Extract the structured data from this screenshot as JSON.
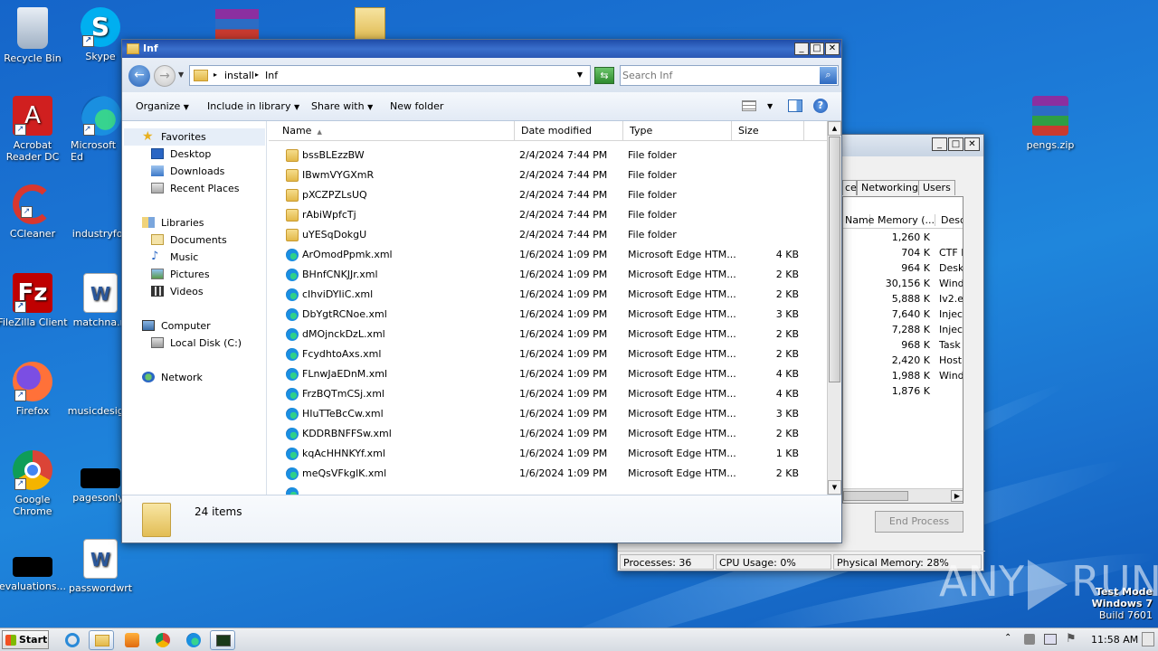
{
  "desktop": {
    "icons": [
      {
        "label": "Recycle Bin",
        "icon": "recycle-bin-icon"
      },
      {
        "label": "Skype",
        "icon": "skype-icon"
      },
      {
        "label": "Acrobat Reader DC",
        "icon": "acrobat-icon"
      },
      {
        "label": "Microsoft Ed",
        "icon": "edge-icon"
      },
      {
        "label": "CCleaner",
        "icon": "ccleaner-icon"
      },
      {
        "label": "industryfoo",
        "icon": "blank-icon"
      },
      {
        "label": "FileZilla Client",
        "icon": "filezilla-icon"
      },
      {
        "label": "matchna.rt",
        "icon": "word-doc-icon"
      },
      {
        "label": "Firefox",
        "icon": "firefox-icon"
      },
      {
        "label": "musicdesig...",
        "icon": "blank-icon"
      },
      {
        "label": "Google Chrome",
        "icon": "chrome-icon"
      },
      {
        "label": "pagesonly.j",
        "icon": "black-thumb-icon"
      },
      {
        "label": "evaluations...",
        "icon": "black-thumb-icon"
      },
      {
        "label": "passwordwrt",
        "icon": "word-doc-icon"
      },
      {
        "label": "pengs.zip",
        "icon": "winrar-icon"
      }
    ],
    "watermark": {
      "brand": "ANY",
      "brand2": "RUN"
    },
    "test_mode": {
      "line1": "Test Mode",
      "line2": "Windows 7",
      "line3": "Build 7601"
    }
  },
  "explorer": {
    "title": "Inf",
    "breadcrumb": [
      "install",
      "Inf"
    ],
    "search_placeholder": "Search Inf",
    "toolbar": {
      "organize": "Organize",
      "include": "Include in library",
      "share": "Share with",
      "new_folder": "New folder"
    },
    "nav": {
      "favorites": "Favorites",
      "desktop": "Desktop",
      "downloads": "Downloads",
      "recent": "Recent Places",
      "libraries": "Libraries",
      "documents": "Documents",
      "music": "Music",
      "pictures": "Pictures",
      "videos": "Videos",
      "computer": "Computer",
      "local_disk": "Local Disk (C:)",
      "network": "Network"
    },
    "columns": {
      "name": "Name",
      "date": "Date modified",
      "type": "Type",
      "size": "Size"
    },
    "files": [
      {
        "name": "bssBLEzzBW",
        "date": "2/4/2024 7:44 PM",
        "type": "File folder",
        "size": "",
        "kind": "folder"
      },
      {
        "name": "IBwmVYGXmR",
        "date": "2/4/2024 7:44 PM",
        "type": "File folder",
        "size": "",
        "kind": "folder"
      },
      {
        "name": "pXCZPZLsUQ",
        "date": "2/4/2024 7:44 PM",
        "type": "File folder",
        "size": "",
        "kind": "folder"
      },
      {
        "name": "rAbiWpfcTj",
        "date": "2/4/2024 7:44 PM",
        "type": "File folder",
        "size": "",
        "kind": "folder"
      },
      {
        "name": "uYESqDokgU",
        "date": "2/4/2024 7:44 PM",
        "type": "File folder",
        "size": "",
        "kind": "folder"
      },
      {
        "name": "ArOmodPpmk.xml",
        "date": "1/6/2024 1:09 PM",
        "type": "Microsoft Edge HTM...",
        "size": "4 KB",
        "kind": "edge"
      },
      {
        "name": "BHnfCNKJJr.xml",
        "date": "1/6/2024 1:09 PM",
        "type": "Microsoft Edge HTM...",
        "size": "2 KB",
        "kind": "edge"
      },
      {
        "name": "cIhviDYIiC.xml",
        "date": "1/6/2024 1:09 PM",
        "type": "Microsoft Edge HTM...",
        "size": "2 KB",
        "kind": "edge"
      },
      {
        "name": "DbYgtRCNoe.xml",
        "date": "1/6/2024 1:09 PM",
        "type": "Microsoft Edge HTM...",
        "size": "3 KB",
        "kind": "edge"
      },
      {
        "name": "dMOjnckDzL.xml",
        "date": "1/6/2024 1:09 PM",
        "type": "Microsoft Edge HTM...",
        "size": "2 KB",
        "kind": "edge"
      },
      {
        "name": "FcydhtoAxs.xml",
        "date": "1/6/2024 1:09 PM",
        "type": "Microsoft Edge HTM...",
        "size": "2 KB",
        "kind": "edge"
      },
      {
        "name": "FLnwJaEDnM.xml",
        "date": "1/6/2024 1:09 PM",
        "type": "Microsoft Edge HTM...",
        "size": "4 KB",
        "kind": "edge"
      },
      {
        "name": "FrzBQTmCSj.xml",
        "date": "1/6/2024 1:09 PM",
        "type": "Microsoft Edge HTM...",
        "size": "4 KB",
        "kind": "edge"
      },
      {
        "name": "HIuTTeBcCw.xml",
        "date": "1/6/2024 1:09 PM",
        "type": "Microsoft Edge HTM...",
        "size": "3 KB",
        "kind": "edge"
      },
      {
        "name": "KDDRBNFFSw.xml",
        "date": "1/6/2024 1:09 PM",
        "type": "Microsoft Edge HTM...",
        "size": "2 KB",
        "kind": "edge"
      },
      {
        "name": "kqAcHHNKYf.xml",
        "date": "1/6/2024 1:09 PM",
        "type": "Microsoft Edge HTM...",
        "size": "1 KB",
        "kind": "edge"
      },
      {
        "name": "meQsVFkglK.xml",
        "date": "1/6/2024 1:09 PM",
        "type": "Microsoft Edge HTM...",
        "size": "2 KB",
        "kind": "edge"
      }
    ],
    "status": "24 items"
  },
  "task_manager": {
    "tabs": [
      "ce",
      "Networking",
      "Users"
    ],
    "columns": {
      "name": "Name",
      "memory": "Memory (...",
      "desc": "Desc"
    },
    "rows": [
      {
        "mem": "1,260 K",
        "desc": ""
      },
      {
        "mem": "704 K",
        "desc": "CTF I"
      },
      {
        "mem": "964 K",
        "desc": "Desk"
      },
      {
        "mem": "30,156 K",
        "desc": "Wind"
      },
      {
        "mem": "5,888 K",
        "desc": "Iv2.e"
      },
      {
        "mem": "7,640 K",
        "desc": "Injec"
      },
      {
        "mem": "7,288 K",
        "desc": "Injec"
      },
      {
        "mem": "968 K",
        "desc": "Task"
      },
      {
        "mem": "2,420 K",
        "desc": "Host"
      },
      {
        "mem": "1,988 K",
        "desc": "Wind"
      },
      {
        "mem": "1,876 K",
        "desc": ""
      }
    ],
    "end_process": "End Process",
    "status": {
      "processes": "Processes: 36",
      "cpu": "CPU Usage: 0%",
      "memory": "Physical Memory: 28%"
    }
  },
  "taskbar": {
    "start": "Start",
    "clock": "11:58 AM"
  }
}
